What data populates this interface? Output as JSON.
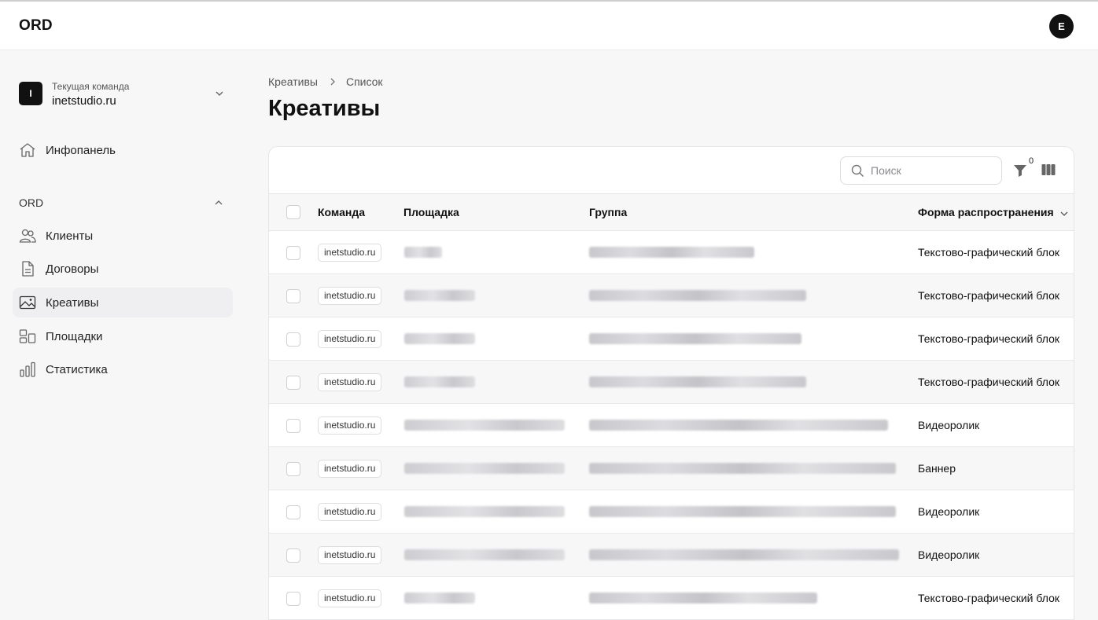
{
  "header": {
    "logo": "ORD",
    "avatar_letter": "E"
  },
  "sidebar": {
    "team": {
      "logo_letter": "I",
      "caption": "Текущая команда",
      "name": "inetstudio.ru"
    },
    "dashboard": {
      "label": "Инфопанель",
      "icon": "home-icon"
    },
    "section": {
      "label": "ORD"
    },
    "items": [
      {
        "label": "Клиенты",
        "icon": "users-icon"
      },
      {
        "label": "Договоры",
        "icon": "document-icon"
      },
      {
        "label": "Креативы",
        "icon": "image-icon",
        "active": true
      },
      {
        "label": "Площадки",
        "icon": "layout-icon"
      },
      {
        "label": "Статистика",
        "icon": "chart-icon"
      }
    ]
  },
  "breadcrumb": {
    "root": "Креативы",
    "current": "Список"
  },
  "page": {
    "title": "Креативы"
  },
  "toolbar": {
    "search_placeholder": "Поиск",
    "filter_count": "0"
  },
  "table": {
    "columns": {
      "team": "Команда",
      "platform": "Площадка",
      "group": "Группа",
      "form": "Форма распространения"
    },
    "rows": [
      {
        "team": "inetstudio.ru",
        "form": "Текстово-графический блок"
      },
      {
        "team": "inetstudio.ru",
        "form": "Текстово-графический блок"
      },
      {
        "team": "inetstudio.ru",
        "form": "Текстово-графический блок"
      },
      {
        "team": "inetstudio.ru",
        "form": "Текстово-графический блок"
      },
      {
        "team": "inetstudio.ru",
        "form": "Видеоролик"
      },
      {
        "team": "inetstudio.ru",
        "form": "Баннер"
      },
      {
        "team": "inetstudio.ru",
        "form": "Видеоролик"
      },
      {
        "team": "inetstudio.ru",
        "form": "Видеоролик"
      },
      {
        "team": "inetstudio.ru",
        "form": "Текстово-графический блок"
      }
    ]
  }
}
